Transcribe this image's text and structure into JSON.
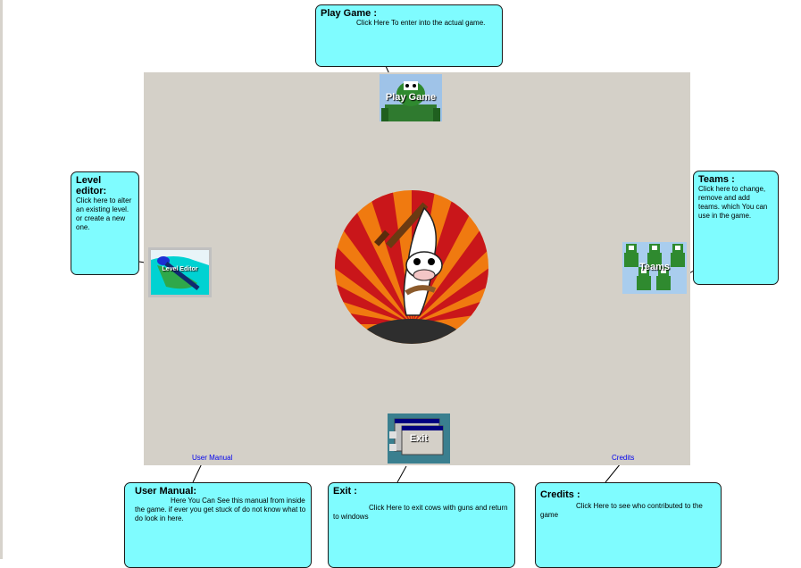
{
  "callouts": {
    "play": {
      "title": "Play Game :",
      "text": "Click Here To enter into the actual game."
    },
    "level": {
      "title": "Level editor:",
      "text": "Click here to alter an existing level. or create a new one."
    },
    "teams": {
      "title": "Teams :",
      "text": "Click here to change, remove and add teams. which You can use in the game."
    },
    "manual": {
      "title": "User Manual:",
      "text": "Here You Can See this manual from inside the game. if ever you get stuck of do not know what to do look in here."
    },
    "exit": {
      "title": "Exit :",
      "text": "Click Here to exit cows with guns and return to windows"
    },
    "credits": {
      "title": "Credits :",
      "text": "Click Here to see who contributed to the game"
    }
  },
  "buttons": {
    "play": "Play Game",
    "level_editor": "Level Editor",
    "teams": "Teams",
    "exit": "Exit"
  },
  "links": {
    "user_manual": "User Manual",
    "credits": "Credits"
  }
}
